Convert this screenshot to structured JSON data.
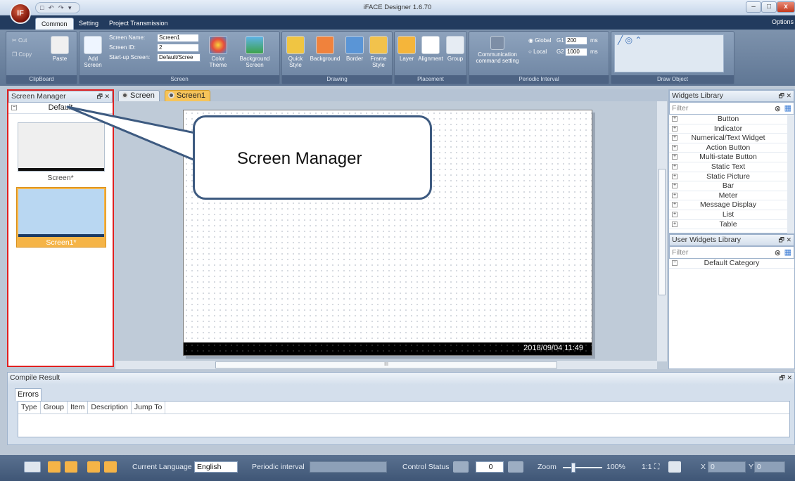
{
  "app": {
    "title": "iFACE Designer 1.6.70",
    "logo_text": "iF",
    "quick_access_icons": "□ ↶ ↷ ▾",
    "window_buttons": {
      "minimize": "–",
      "maximize": "□",
      "close": "x"
    }
  },
  "ribbon": {
    "tabs": [
      "Common",
      "Setting",
      "Project Transmission"
    ],
    "active_tab": "Common",
    "options_label": "Options",
    "clipboard": {
      "cut": "Cut",
      "copy": "Copy",
      "paste": "Paste",
      "group_label": "ClipBoard"
    },
    "screen": {
      "add_screen": "Add Screen",
      "name_label": "Screen Name:",
      "name_value": "Screen1",
      "id_label": "Screen ID:",
      "id_value": "2",
      "startup_label": "Start-up Screen:",
      "startup_value": "Default/Scree",
      "color_theme": "Color Theme",
      "background_screen": "Background Screen",
      "group_label": "Screen"
    },
    "drawing": {
      "quick_style": "Quick Style",
      "background": "Background",
      "border": "Border",
      "frame_style": "Frame Style",
      "group_label": "Drawing"
    },
    "placement": {
      "layer": "Layer",
      "alignment": "Alignment",
      "group": "Group",
      "group_label": "Placement"
    },
    "periodic": {
      "comm_setting": "Communication command setting",
      "global_label": "Global",
      "local_label": "Local",
      "g1_label": "G1",
      "g1_value": "200",
      "g2_label": "G2",
      "g2_value": "1000",
      "unit": "ms",
      "group_label": "Periodic Interval"
    },
    "draw_object": {
      "group_label": "Draw Object"
    }
  },
  "screen_manager": {
    "title": "Screen Manager",
    "category": "Default",
    "screens": [
      {
        "label": "Screen*",
        "color": "#efefef"
      },
      {
        "label": "Screen1*",
        "color": "#b9d7f2"
      }
    ]
  },
  "editor": {
    "tabs": [
      "Screen",
      "Screen1"
    ],
    "active_tab": "Screen1",
    "status_time": "2018/09/04   11:49",
    "scroll_marker": "III"
  },
  "callout": {
    "text": "Screen Manager"
  },
  "widgets_library": {
    "title": "Widgets Library",
    "filter_placeholder": "Filter",
    "items": [
      "Button",
      "Indicator",
      "Numerical/Text Widget",
      "Action Button",
      "Multi-state Button",
      "Static Text",
      "Static Picture",
      "Bar",
      "Meter",
      "Message Display",
      "List",
      "Table"
    ]
  },
  "user_widgets_library": {
    "title": "User Widgets Library",
    "filter_placeholder": "Filter",
    "items": [
      "Default Category"
    ]
  },
  "compile_result": {
    "title": "Compile Result",
    "tab": "Errors",
    "columns": [
      "Type",
      "Group",
      "Item",
      "Description",
      "Jump To"
    ]
  },
  "statusbar": {
    "language_label": "Current Language",
    "language_value": "English",
    "periodic_label": "Periodic interval",
    "control_status_label": "Control Status",
    "control_status_value": "0",
    "zoom_label": "Zoom",
    "zoom_value": "100%",
    "zoom_ratio": "1:1",
    "x_label": "X",
    "x_value": "0",
    "y_label": "Y",
    "y_value": "0"
  },
  "colors": {
    "highlight_border": "#e02020",
    "callout_border": "#3d5a80",
    "active_tab": "#f6c45a"
  }
}
